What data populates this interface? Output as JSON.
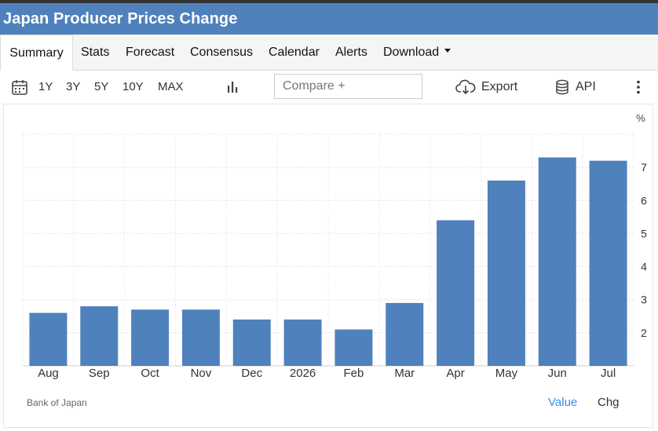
{
  "header": {
    "title": "Japan Producer Prices Change"
  },
  "tabs": [
    {
      "label": "Summary",
      "active": true
    },
    {
      "label": "Stats"
    },
    {
      "label": "Forecast"
    },
    {
      "label": "Consensus"
    },
    {
      "label": "Calendar"
    },
    {
      "label": "Alerts"
    },
    {
      "label": "Download"
    }
  ],
  "toolbar": {
    "ranges": [
      "1Y",
      "3Y",
      "5Y",
      "10Y",
      "MAX"
    ],
    "compare_placeholder": "Compare +",
    "export_label": "Export",
    "api_label": "API",
    "icons": [
      "calendar-icon",
      "bar-chart-icon",
      "cloud-download-icon",
      "database-icon",
      "more-vertical-icon"
    ]
  },
  "chart_data": {
    "type": "bar",
    "categories": [
      "Aug",
      "Sep",
      "Oct",
      "Nov",
      "Dec",
      "2026",
      "Feb",
      "Mar",
      "Apr",
      "May",
      "Jun",
      "Jul"
    ],
    "values": [
      2.6,
      2.8,
      2.7,
      2.7,
      2.4,
      2.4,
      2.1,
      2.9,
      5.4,
      6.6,
      7.3,
      7.2
    ],
    "y_unit": "%",
    "y_ticks": [
      2,
      3,
      4,
      5,
      6,
      7
    ],
    "ylim": [
      1,
      8
    ],
    "bar_color": "#4f81bd",
    "grid": true
  },
  "footer": {
    "source": "Bank of Japan",
    "value_label": "Value",
    "chg_label": "Chg"
  },
  "colors": {
    "header_bg": "#4f81bd",
    "link": "#3a8fd9"
  }
}
